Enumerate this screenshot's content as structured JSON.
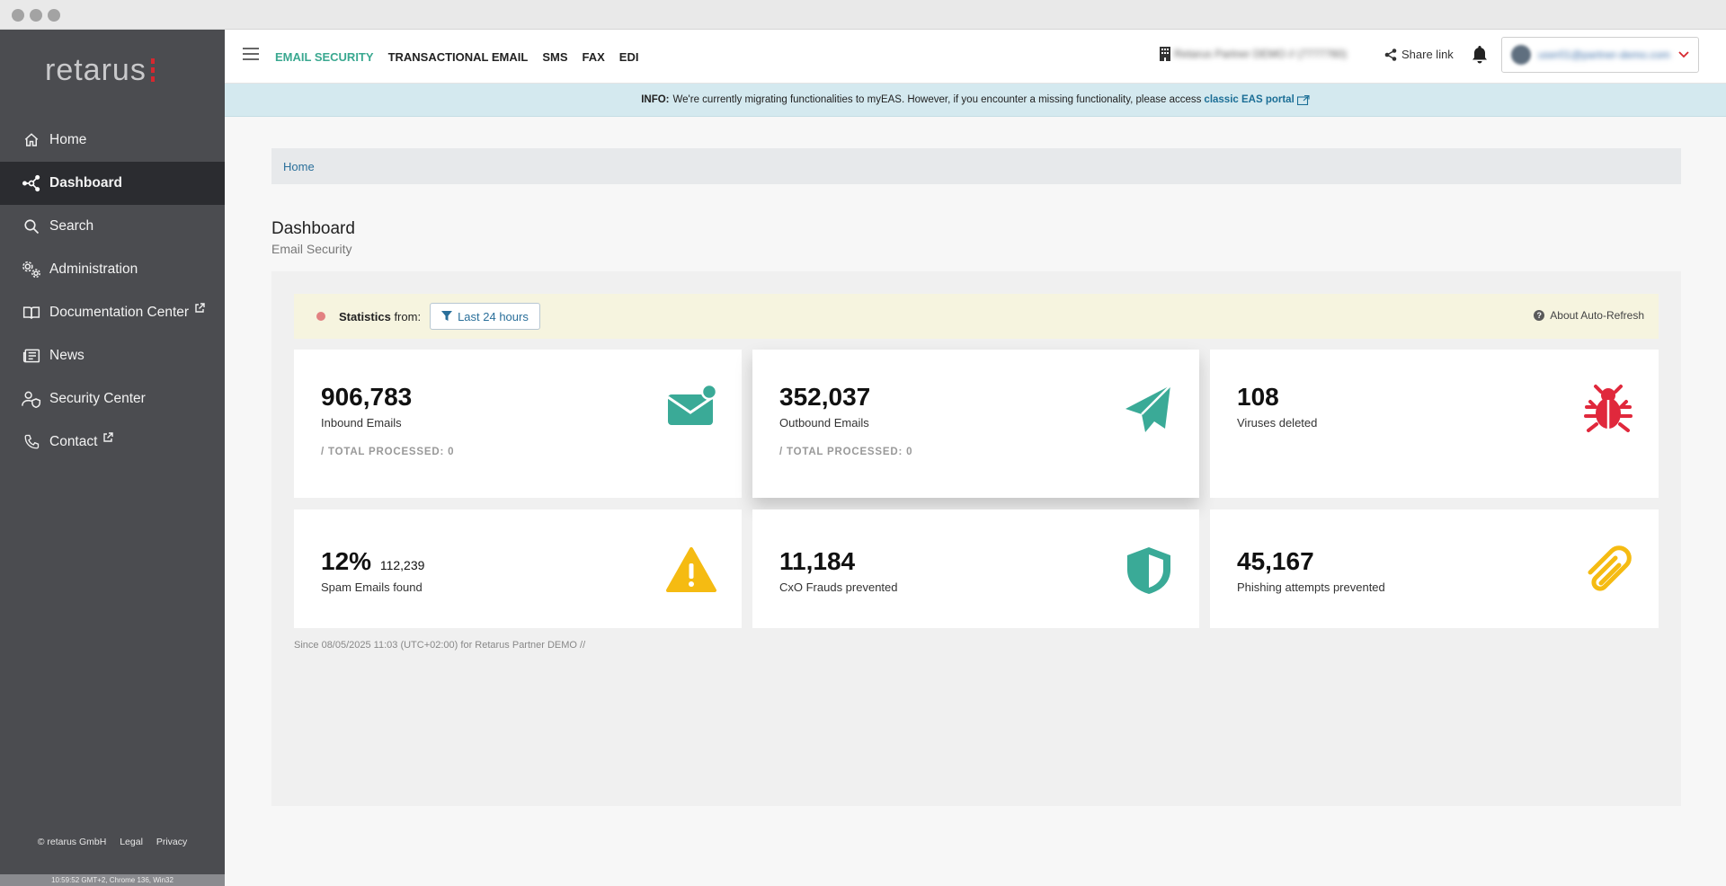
{
  "sidebar": {
    "logo": "retarus",
    "items": [
      {
        "label": "Home",
        "icon": "home-icon",
        "active": false,
        "external": false
      },
      {
        "label": "Dashboard",
        "icon": "network-icon",
        "active": true,
        "external": false
      },
      {
        "label": "Search",
        "icon": "search-icon",
        "active": false,
        "external": false
      },
      {
        "label": "Administration",
        "icon": "gears-icon",
        "active": false,
        "external": false
      },
      {
        "label": "Documentation Center",
        "icon": "book-icon",
        "active": false,
        "external": true
      },
      {
        "label": "News",
        "icon": "newspaper-icon",
        "active": false,
        "external": false
      },
      {
        "label": "Security Center",
        "icon": "user-shield-icon",
        "active": false,
        "external": false
      },
      {
        "label": "Contact",
        "icon": "phone-icon",
        "active": false,
        "external": true
      }
    ],
    "footer": {
      "copyright": "© retarus GmbH",
      "legal": "Legal",
      "privacy": "Privacy"
    },
    "status": "10:59:52 GMT+2, Chrome 136, Win32"
  },
  "topbar": {
    "tabs": [
      "EMAIL SECURITY",
      "TRANSACTIONAL EMAIL",
      "SMS",
      "FAX",
      "EDI"
    ],
    "active_tab": "EMAIL SECURITY",
    "tenant": "Retarus Partner DEMO // (7777760)",
    "share_label": "Share link",
    "user": "user01@partner-demo.com"
  },
  "info": {
    "prefix": "INFO:",
    "text": "We're currently migrating functionalities to myEAS. However, if you encounter a missing functionality, please access",
    "link": "classic EAS portal"
  },
  "breadcrumb": {
    "home": "Home"
  },
  "page": {
    "title": "Dashboard",
    "subtitle": "Email Security"
  },
  "stats": {
    "label_bold": "Statistics",
    "label_rest": "from:",
    "filter": "Last 24 hours",
    "auto_refresh": "About Auto-Refresh",
    "help": "?"
  },
  "cards": {
    "inbound": {
      "value": "906,783",
      "label": "Inbound Emails",
      "total": "/ TOTAL PROCESSED: 0"
    },
    "outbound": {
      "value": "352,037",
      "label": "Outbound Emails",
      "total": "/ TOTAL PROCESSED: 0"
    },
    "viruses": {
      "value": "108",
      "label": "Viruses deleted"
    },
    "spam": {
      "value": "12%",
      "sub": "112,239",
      "label": "Spam Emails found"
    },
    "cxo": {
      "value": "11,184",
      "label": "CxO Frauds prevented"
    },
    "phishing": {
      "value": "45,167",
      "label": "Phishing attempts prevented"
    }
  },
  "since": "Since 08/05/2025 11:03 (UTC+02:00) for Retarus Partner DEMO //",
  "colors": {
    "teal": "#3aaa97",
    "red": "#e0283c",
    "yellow": "#f5bb12",
    "sidebar": "#4b4c50"
  }
}
